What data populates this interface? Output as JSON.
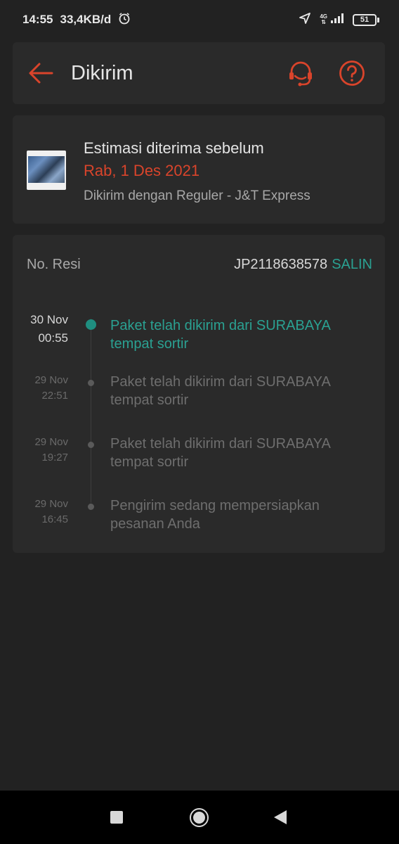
{
  "status_bar": {
    "time": "14:55",
    "net_speed": "33,4KB/d",
    "network_type": "4G",
    "battery": "51",
    "icons": [
      "alarm-icon",
      "location-arrow-icon",
      "signal-icon",
      "battery-icon"
    ]
  },
  "header": {
    "title": "Dikirim",
    "back_icon": "back-arrow-icon",
    "support_icon": "headset-icon",
    "help_icon": "help-icon"
  },
  "delivery": {
    "estimate_label": "Estimasi diterima sebelum",
    "estimate_date": "Rab, 1 Des 2021",
    "shipping_method": "Dikirim dengan Reguler - J&T Express"
  },
  "tracking": {
    "resi_label": "No. Resi",
    "resi_number": "JP2118638578",
    "copy_label": "SALIN",
    "events": [
      {
        "date": "30 Nov",
        "time": "00:55",
        "text": "Paket telah dikirim dari SURABAYA tempat sortir",
        "active": true
      },
      {
        "date": "29 Nov",
        "time": "22:51",
        "text": "Paket telah dikirim dari SURABAYA tempat sortir",
        "active": false
      },
      {
        "date": "29 Nov",
        "time": "19:27",
        "text": "Paket telah dikirim dari SURABAYA tempat sortir",
        "active": false
      },
      {
        "date": "29 Nov",
        "time": "16:45",
        "text": "Pengirim sedang mempersiapkan pesanan Anda",
        "active": false
      }
    ]
  },
  "colors": {
    "accent": "#d9442b",
    "teal": "#2aa192",
    "background": "#222222",
    "card": "#2a2a2a"
  },
  "nav_bar": {
    "icons": [
      "recents-icon",
      "home-icon",
      "back-icon"
    ]
  }
}
